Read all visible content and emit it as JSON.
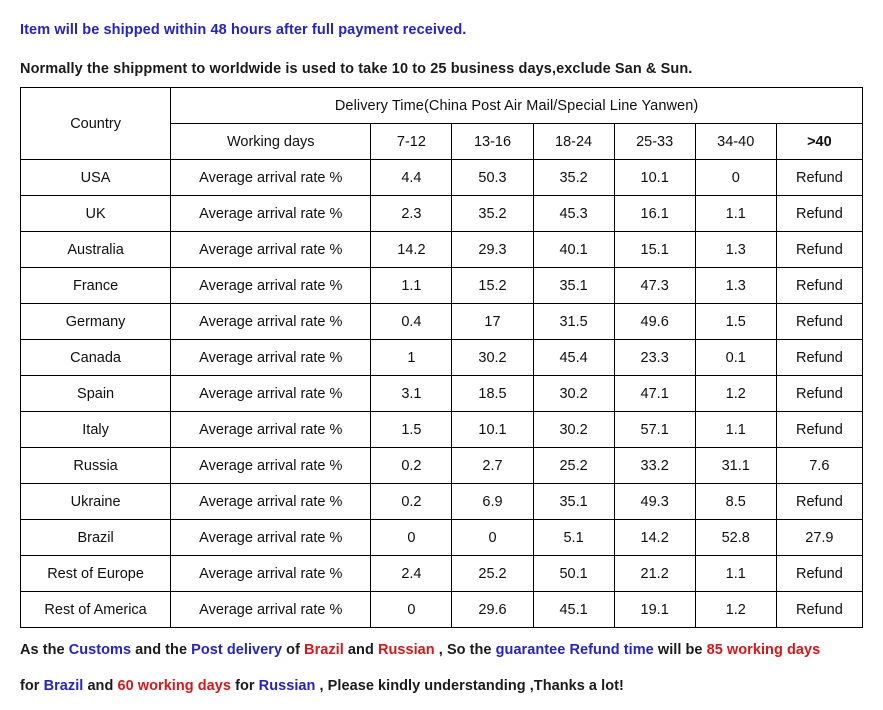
{
  "intro": {
    "line1": "Item will be shipped within 48 hours after full payment received.",
    "line2": "Normally the shippment to worldwide is used to take 10 to 25 business days,exclude San & Sun."
  },
  "table": {
    "country_header": "Country",
    "delivery_header": "Delivery Time(China Post Air Mail/Special Line Yanwen)",
    "working_days_header": "Working days",
    "buckets": [
      "7-12",
      "13-16",
      "18-24",
      "25-33",
      "34-40",
      ">40"
    ],
    "metric_label": "Average arrival rate %",
    "refund_label": "Refund",
    "rows": [
      {
        "country": "USA",
        "metric": "Average arrival rate %",
        "values": [
          "4.4",
          "50.3",
          "35.2",
          "10.1",
          "0",
          "Refund"
        ],
        "over_is_refund": true
      },
      {
        "country": "UK",
        "metric": "Average arrival rate %",
        "values": [
          "2.3",
          "35.2",
          "45.3",
          "16.1",
          "1.1",
          "Refund"
        ],
        "over_is_refund": true
      },
      {
        "country": "Australia",
        "metric": "Average arrival rate %",
        "values": [
          "14.2",
          "29.3",
          "40.1",
          "15.1",
          "1.3",
          "Refund"
        ],
        "over_is_refund": true
      },
      {
        "country": "France",
        "metric": "Average arrival rate %",
        "values": [
          "1.1",
          "15.2",
          "35.1",
          "47.3",
          "1.3",
          "Refund"
        ],
        "over_is_refund": true
      },
      {
        "country": "Germany",
        "metric": "Average arrival rate %",
        "values": [
          "0.4",
          "17",
          "31.5",
          "49.6",
          "1.5",
          "Refund"
        ],
        "over_is_refund": true
      },
      {
        "country": "Canada",
        "metric": "Average arrival rate %",
        "values": [
          "1",
          "30.2",
          "45.4",
          "23.3",
          "0.1",
          "Refund"
        ],
        "over_is_refund": true
      },
      {
        "country": "Spain",
        "metric": "Average arrival rate %",
        "values": [
          "3.1",
          "18.5",
          "30.2",
          "47.1",
          "1.2",
          "Refund"
        ],
        "over_is_refund": true
      },
      {
        "country": "Italy",
        "metric": "Average arrival rate %",
        "values": [
          "1.5",
          "10.1",
          "30.2",
          "57.1",
          "1.1",
          "Refund"
        ],
        "over_is_refund": true
      },
      {
        "country": "Russia",
        "metric": "Average arrival rate %",
        "values": [
          "0.2",
          "2.7",
          "25.2",
          "33.2",
          "31.1",
          "7.6"
        ],
        "over_is_refund": false
      },
      {
        "country": "Ukraine",
        "metric": "Average arrival rate %",
        "values": [
          "0.2",
          "6.9",
          "35.1",
          "49.3",
          "8.5",
          "Refund"
        ],
        "over_is_refund": true
      },
      {
        "country": "Brazil",
        "metric": "Average arrival rate %",
        "values": [
          "0",
          "0",
          "5.1",
          "14.2",
          "52.8",
          "27.9"
        ],
        "over_is_refund": false
      },
      {
        "country": "Rest of Europe",
        "metric": "Average arrival rate %",
        "values": [
          "2.4",
          "25.2",
          "50.1",
          "21.2",
          "1.1",
          "Refund"
        ],
        "over_is_refund": true
      },
      {
        "country": "Rest of America",
        "metric": "Average arrival rate %",
        "values": [
          "0",
          "29.6",
          "45.1",
          "19.1",
          "1.2",
          "Refund"
        ],
        "over_is_refund": true
      }
    ]
  },
  "footer": {
    "line1": [
      {
        "text": "As the ",
        "color": "black"
      },
      {
        "text": "Customs",
        "color": "blue"
      },
      {
        "text": " and the ",
        "color": "black"
      },
      {
        "text": "Post delivery",
        "color": "blue"
      },
      {
        "text": " of ",
        "color": "black"
      },
      {
        "text": "Brazil",
        "color": "red"
      },
      {
        "text": " and ",
        "color": "black"
      },
      {
        "text": "Russian",
        "color": "red"
      },
      {
        "text": " , So the ",
        "color": "black"
      },
      {
        "text": "guarantee Refund time",
        "color": "blue"
      },
      {
        "text": " will be ",
        "color": "black"
      },
      {
        "text": "85 working days",
        "color": "red"
      }
    ],
    "line2": [
      {
        "text": "for ",
        "color": "black"
      },
      {
        "text": "Brazil",
        "color": "blue"
      },
      {
        "text": " and ",
        "color": "black"
      },
      {
        "text": "60 working days",
        "color": "red"
      },
      {
        "text": " for ",
        "color": "black"
      },
      {
        "text": "Russian",
        "color": "blue"
      },
      {
        "text": " , Please kindly understanding ,Thanks a lot!",
        "color": "black"
      }
    ]
  },
  "colors": {
    "blue": "#2323c8",
    "red": "#d81818",
    "black": "#1a1a1a",
    "border": "#000000"
  }
}
